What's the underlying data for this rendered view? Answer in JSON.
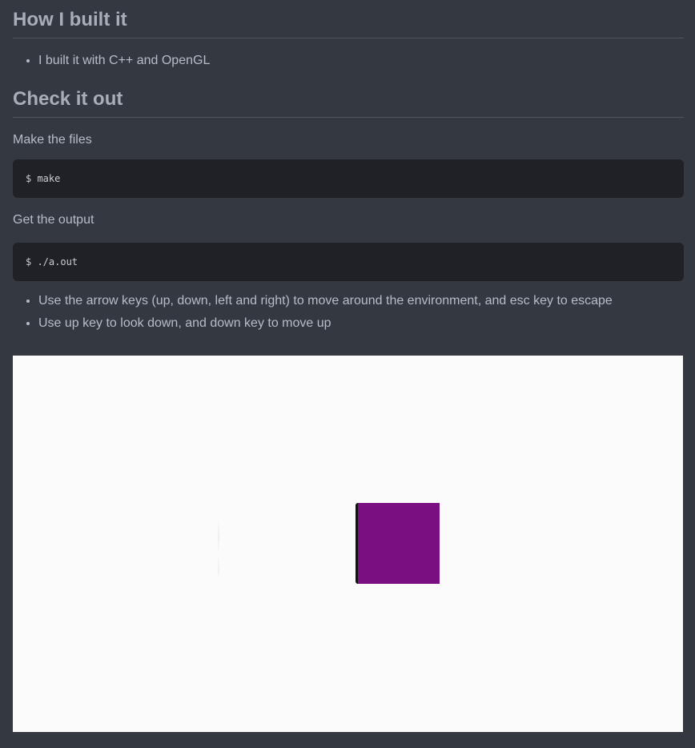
{
  "sections": {
    "built": {
      "heading": "How I built it",
      "items": [
        "I built it with C++ and OpenGL"
      ]
    },
    "check": {
      "heading": "Check it out",
      "step1": "Make the files",
      "code1": "$ make",
      "step2": "Get the output",
      "code2": "$ ./a.out",
      "items": [
        "Use the arrow keys (up, down, left and right) to move around the environment, and esc key to escape",
        "Use up key to look down, and down key to move up"
      ]
    }
  },
  "demo": {
    "background_color": "#fbfbfb",
    "cube_color": "#7a0f82"
  }
}
